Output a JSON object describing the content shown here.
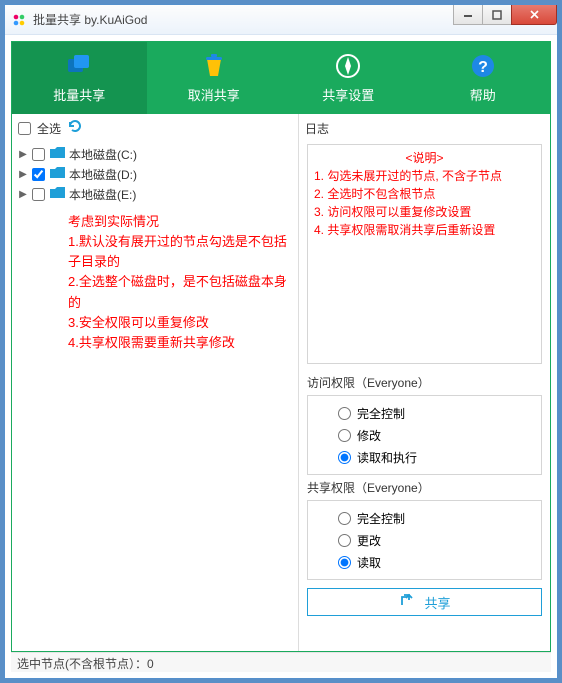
{
  "window": {
    "title": "批量共享 by.KuAiGod"
  },
  "tabs": {
    "bulk_share": "批量共享",
    "cancel_share": "取消共享",
    "share_settings": "共享设置",
    "help": "帮助"
  },
  "left": {
    "select_all": "全选",
    "drives": [
      {
        "label": "本地磁盘(C:)",
        "checked": false
      },
      {
        "label": "本地磁盘(D:)",
        "checked": true
      },
      {
        "label": "本地磁盘(E:)",
        "checked": false
      }
    ],
    "red_notes": {
      "heading": "考虑到实际情况",
      "l1": "1.默认没有展开过的节点勾选是不包括子目录的",
      "l2": "2.全选整个磁盘时，是不包括磁盘本身的",
      "l3": "3.安全权限可以重复修改",
      "l4": "4.共享权限需要重新共享修改"
    }
  },
  "right": {
    "log_label": "日志",
    "log": {
      "title": "<说明>",
      "l1": "1. 勾选未展开过的节点, 不含子节点",
      "l2": "2. 全选时不包含根节点",
      "l3": "3. 访问权限可以重复修改设置",
      "l4": "4. 共享权限需取消共享后重新设置"
    },
    "access_perm": {
      "title": "访问权限（Everyone）",
      "options": {
        "full": "完全控制",
        "modify": "修改",
        "read_exec": "读取和执行"
      },
      "selected": "read_exec"
    },
    "share_perm": {
      "title": "共享权限（Everyone）",
      "options": {
        "full": "完全控制",
        "change": "更改",
        "read": "读取"
      },
      "selected": "read"
    },
    "share_button": "共享"
  },
  "statusbar": "选中节点(不含根节点）：0"
}
